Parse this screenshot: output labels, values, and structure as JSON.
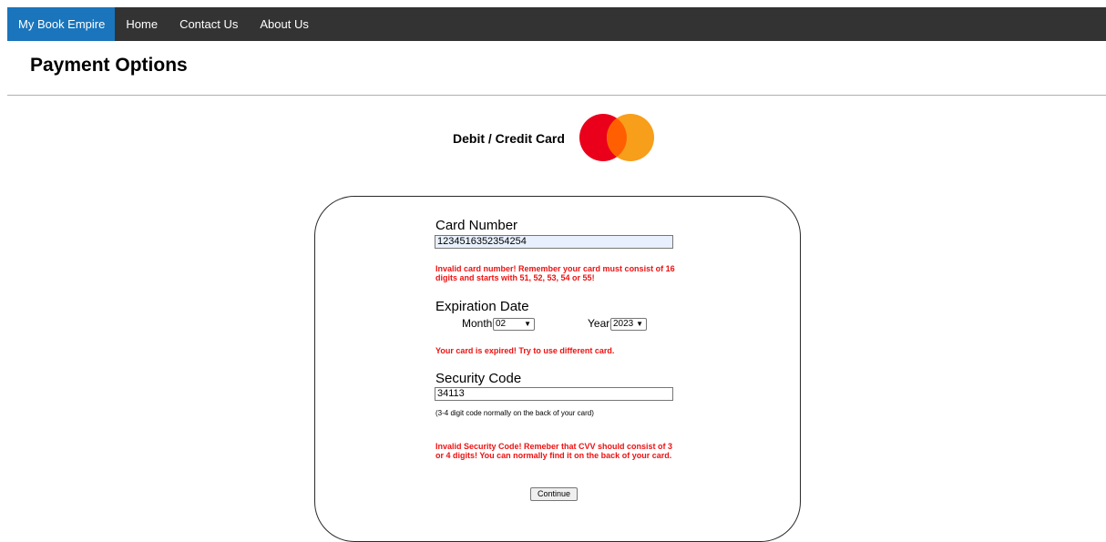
{
  "nav": {
    "brand": "My Book Empire",
    "items": [
      {
        "label": "Home"
      },
      {
        "label": "Contact Us"
      },
      {
        "label": "About Us"
      }
    ]
  },
  "page": {
    "title": "Payment Options"
  },
  "payment_method": {
    "label": "Debit / Credit Card",
    "logo": "mastercard-logo",
    "colors": {
      "red": "#eb001b",
      "orange": "#f79e1b",
      "overlap": "#ff5f00"
    }
  },
  "form": {
    "card_number": {
      "label": "Card Number",
      "value": "1234516352354254",
      "error": "Invalid card number! Remember your card must consist of 16 digits and starts with 51, 52, 53, 54 or 55!"
    },
    "expiration": {
      "label": "Expiration Date",
      "month_label": "Month",
      "month_value": "02",
      "year_label": "Year",
      "year_value": "2023",
      "error": "Your card is expired! Try to use different card."
    },
    "security_code": {
      "label": "Security Code",
      "value": "34113",
      "hint": "(3-4 digit code normally on the back of your card)",
      "error": "Invalid Security Code! Remeber that CVV should consist of 3 or 4 digits! You can normally find it on the back of your card."
    },
    "continue_label": "Continue"
  },
  "colors": {
    "nav_bg": "#333333",
    "nav_active": "#1a75bc",
    "error": "#ee1111",
    "autofill_bg": "#e8f0fe"
  }
}
